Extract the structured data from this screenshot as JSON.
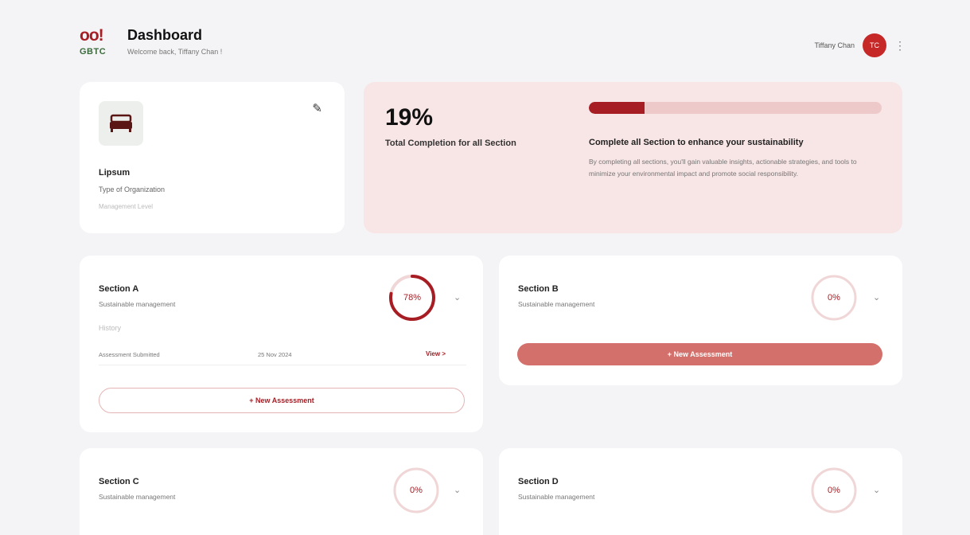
{
  "header": {
    "logo_mark": "oo!",
    "logo_text": "GBTC",
    "title": "Dashboard",
    "subtitle": "Welcome back, Tiffany Chan !",
    "user_name": "Tiffany Chan",
    "avatar_initials": "TC",
    "more_icon": "⋮"
  },
  "org": {
    "name": "Lipsum",
    "type": "Type of Organization",
    "level": "Management Level",
    "icon": "bed-icon",
    "edit_icon": "✎"
  },
  "completion": {
    "percent_label": "19%",
    "percent": 19,
    "label": "Total Completion for all Section",
    "cta_title": "Complete all Section to enhance your sustainability",
    "cta_body": "By completing all sections, you'll gain valuable insights, actionable strategies, and tools to minimize your environmental impact and promote social responsibility."
  },
  "sections": [
    {
      "title": "Section A",
      "subtitle": "Sustainable management",
      "percent": 78,
      "percent_label": "78%",
      "history_label": "History",
      "history": [
        {
          "status": "Assessment Submitted",
          "date": "25 Nov 2024",
          "action": "View >"
        }
      ],
      "button_label": "+ New Assessment"
    },
    {
      "title": "Section B",
      "subtitle": "Sustainable management",
      "percent": 0,
      "percent_label": "0%",
      "button_label": "+ New Assessment"
    },
    {
      "title": "Section C",
      "subtitle": "Sustainable management",
      "percent": 0,
      "percent_label": "0%"
    },
    {
      "title": "Section D",
      "subtitle": "Sustainable management",
      "percent": 0,
      "percent_label": "0%"
    }
  ],
  "chevron_icon": "⌄",
  "colors": {
    "brand_red": "#a61d24",
    "brand_green": "#3b6b3c",
    "progress_card_bg": "#f8e5e5",
    "filled_button": "#d3706b",
    "ring_track": "#f0d6d6"
  }
}
